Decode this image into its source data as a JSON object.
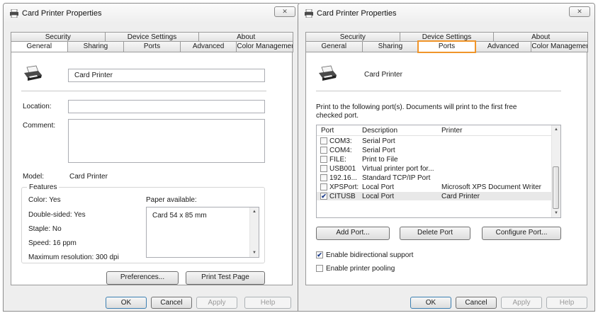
{
  "left_window": {
    "title": "Card Printer Properties",
    "close_glyph": "✕",
    "tabs_top": [
      "Security",
      "Device Settings",
      "About"
    ],
    "tabs_bottom": [
      "General",
      "Sharing",
      "Ports",
      "Advanced",
      "Color Management"
    ],
    "selected_tab": "General",
    "printer_name": "Card Printer",
    "location_label": "Location:",
    "location_value": "",
    "comment_label": "Comment:",
    "comment_value": "",
    "model_label": "Model:",
    "model_value": "Card Printer",
    "features_label": "Features",
    "features": {
      "color": "Color: Yes",
      "double_sided": "Double-sided: Yes",
      "staple": "Staple: No",
      "speed": "Speed: 16 ppm",
      "max_resolution": "Maximum resolution: 300 dpi"
    },
    "paper_available_label": "Paper available:",
    "paper_options": [
      "Card 54 x 85 mm"
    ],
    "preferences_button": "Preferences...",
    "print_test_page_button": "Print Test Page",
    "ok_button": "OK",
    "cancel_button": "Cancel",
    "apply_button": "Apply",
    "help_button": "Help"
  },
  "right_window": {
    "title": "Card Printer Properties",
    "close_glyph": "✕",
    "tabs_top": [
      "Security",
      "Device Settings",
      "About"
    ],
    "tabs_bottom": [
      "General",
      "Sharing",
      "Ports",
      "Advanced",
      "Color Management"
    ],
    "selected_tab": "Ports",
    "highlight_color": "#f0952a",
    "printer_name": "Card Printer",
    "instructions": [
      "Print to the following port(s). Documents will print to the first free",
      "checked port."
    ],
    "columns": [
      "Port",
      "Description",
      "Printer"
    ],
    "ports": [
      {
        "port": "COM3:",
        "description": "Serial Port",
        "printer": "",
        "checked": false
      },
      {
        "port": "COM4:",
        "description": "Serial Port",
        "printer": "",
        "checked": false
      },
      {
        "port": "FILE:",
        "description": "Print to File",
        "printer": "",
        "checked": false
      },
      {
        "port": "USB001",
        "description": "Virtual printer port for...",
        "printer": "",
        "checked": false
      },
      {
        "port": "192.16...",
        "description": "Standard TCP/IP Port",
        "printer": "",
        "checked": false
      },
      {
        "port": "XPSPort:",
        "description": "Local Port",
        "printer": "Microsoft XPS Document Writer",
        "checked": false
      },
      {
        "port": "CITUSB",
        "description": "Local Port",
        "printer": "Card Printer",
        "checked": true
      }
    ],
    "add_port_button": "Add Port...",
    "delete_port_button": "Delete Port",
    "configure_port_button": "Configure Port...",
    "bidirectional_label": "Enable bidirectional support",
    "bidirectional_checked": true,
    "pooling_label": "Enable printer pooling",
    "pooling_checked": false,
    "ok_button": "OK",
    "cancel_button": "Cancel",
    "apply_button": "Apply",
    "help_button": "Help"
  },
  "icons": {
    "printer": "printer-icon",
    "close": "close-icon",
    "check": "✔",
    "scroll_up": "▲",
    "scroll_down": "▼"
  }
}
